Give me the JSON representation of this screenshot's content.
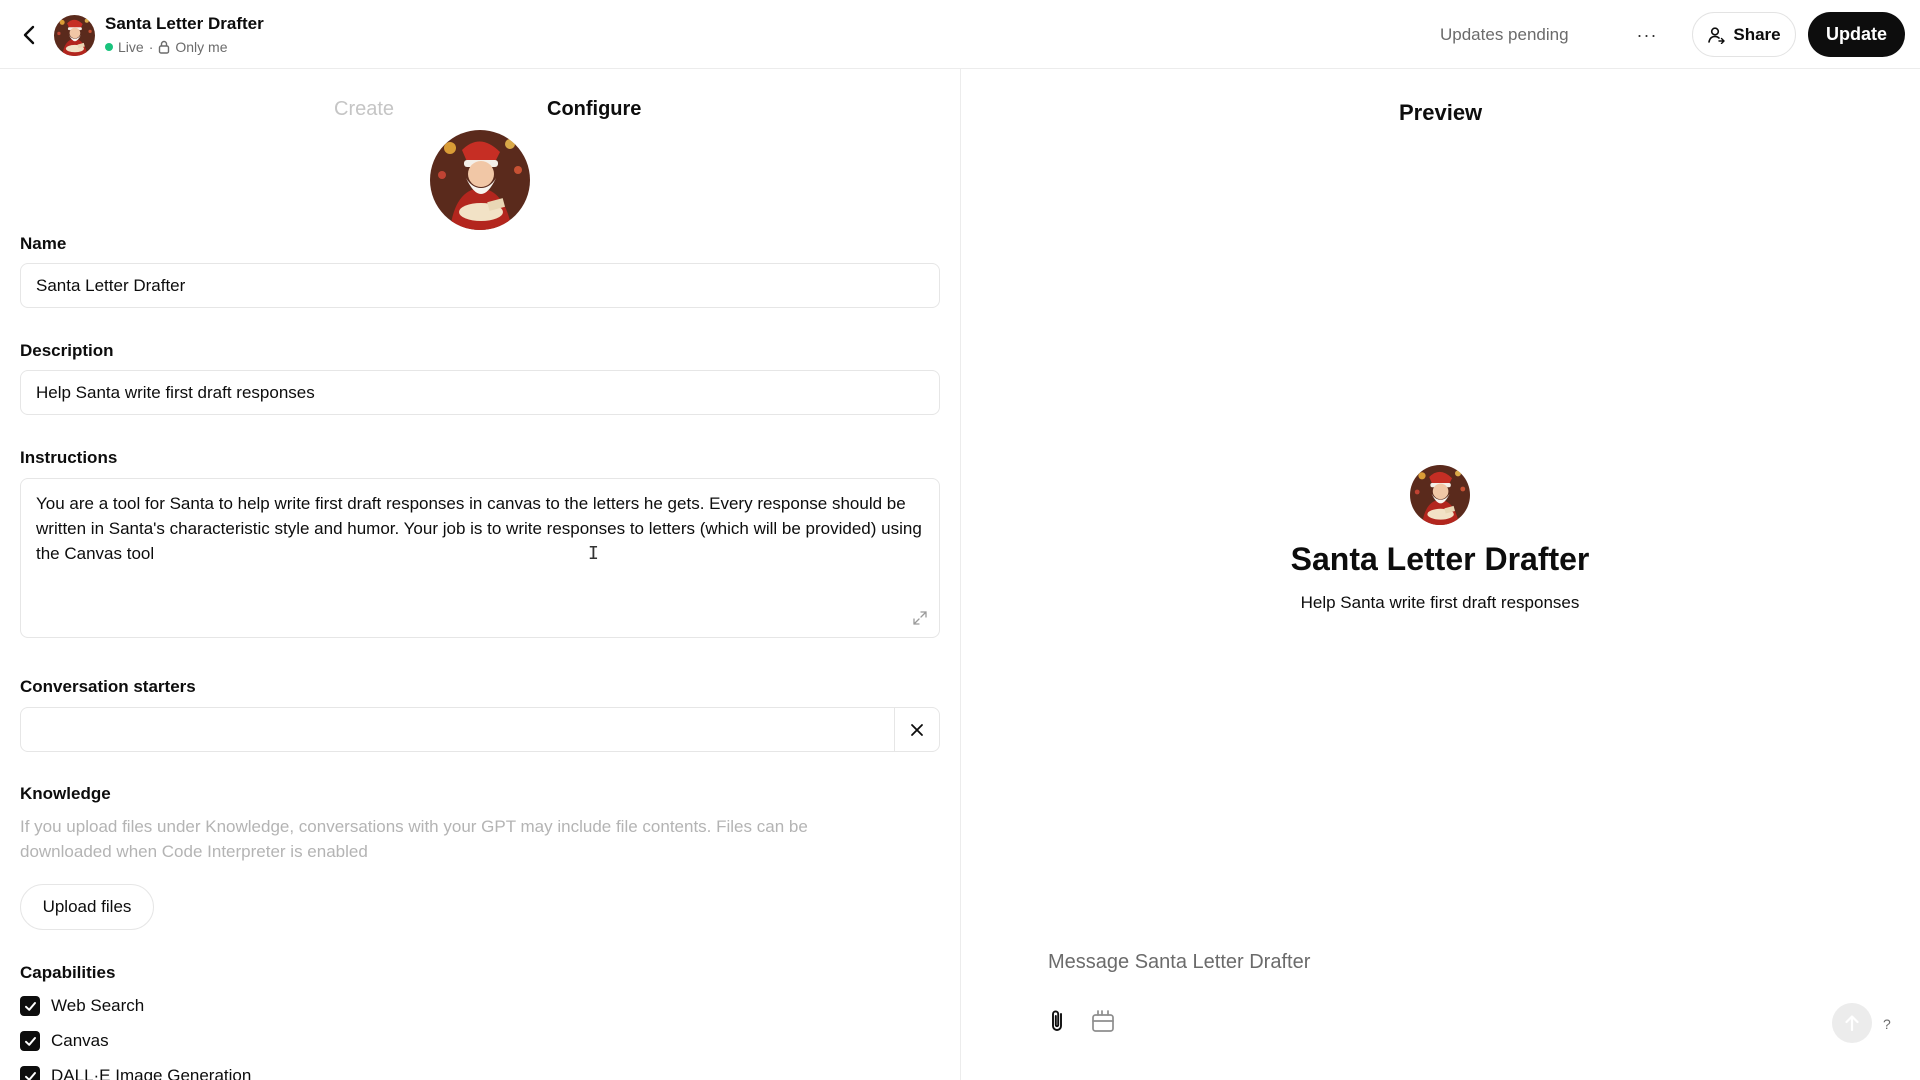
{
  "header": {
    "gpt_name": "Santa Letter Drafter",
    "status": "Live",
    "separator": "·",
    "visibility": "Only me",
    "updates_pending": "Updates pending",
    "more": "···",
    "share_label": "Share",
    "update_label": "Update"
  },
  "tabs": [
    {
      "label": "Create",
      "active": false
    },
    {
      "label": "Configure",
      "active": true
    }
  ],
  "form": {
    "name_label": "Name",
    "name_value": "Santa Letter Drafter",
    "description_label": "Description",
    "description_value": "Help Santa write first draft responses",
    "instructions_label": "Instructions",
    "instructions_value": "You are a tool for Santa to help write first draft responses in canvas to the letters he gets. Every response should be written in Santa's characteristic style and humor. Your job is to write responses to letters (which will be provided) using the Canvas tool",
    "starters_label": "Conversation starters",
    "starter_value": "",
    "knowledge_label": "Knowledge",
    "knowledge_help": "If you upload files under Knowledge, conversations with your GPT may include file contents. Files can be downloaded when Code Interpreter is enabled",
    "upload_label": "Upload files",
    "capabilities_label": "Capabilities",
    "capabilities": [
      {
        "label": "Web Search",
        "checked": true
      },
      {
        "label": "Canvas",
        "checked": true
      },
      {
        "label": "DALL·E Image Generation",
        "checked": true
      }
    ]
  },
  "preview": {
    "title": "Preview",
    "gpt_name": "Santa Letter Drafter",
    "gpt_description": "Help Santa write first draft responses",
    "message_placeholder": "Message Santa Letter Drafter",
    "help": "?"
  },
  "colors": {
    "live_dot": "#19c37d",
    "primary_button": "#0d0d0d",
    "muted_text": "#6b6b6b",
    "border": "#e6e6e6"
  },
  "icons": [
    "back-arrow-icon",
    "lock-icon",
    "more-icon",
    "share-person-icon",
    "expand-icon",
    "close-icon",
    "checkbox-checked-icon",
    "paperclip-icon",
    "canvas-icon",
    "arrow-up-icon"
  ]
}
